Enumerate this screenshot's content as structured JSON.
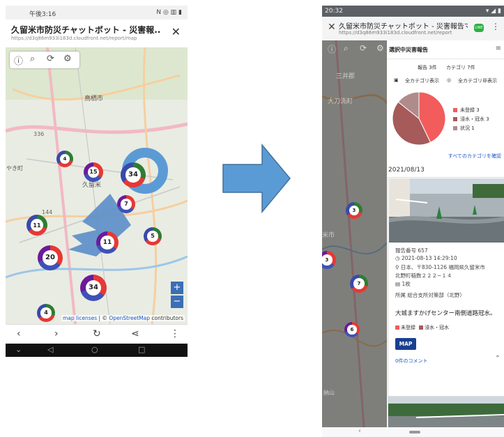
{
  "left_phone": {
    "status_time": "午後3:16",
    "status_right": "N ◎ ▥ ▮",
    "page_title": "久留米市防災チャットボット - 災害報...",
    "url": "https://d3q86m933i183d.cloudfront.net/report/map",
    "map_labels": [
      "鳥栖市",
      "336",
      "やき町",
      "144",
      "久留米"
    ],
    "clusters": [
      "4",
      "15",
      "34",
      "7",
      "11",
      "11",
      "5",
      "20",
      "34",
      "4"
    ],
    "attribution": {
      "link1": "map licenses",
      "sep": " | © ",
      "link2": "OpenStreetMap",
      "suffix": " contributors"
    },
    "zoom_in": "+",
    "zoom_out": "−"
  },
  "right_phone": {
    "status_time": "20:32",
    "status_right": "▾ ◢ ▮",
    "page_title": "久留米市防災チャットボット - 災害報告マ...",
    "url": "https://d3q86m933i183d.cloudfront.net/report",
    "line_badge": "LINE",
    "map_labels": [
      "三井郡",
      "大刀洗町",
      "米市",
      "納山"
    ],
    "map_clusters": [
      "3",
      "3",
      "7",
      "6"
    ],
    "panel": {
      "header": "選択中災害報告",
      "report_count": "報告 3件",
      "category_count": "カテゴリ 7件",
      "show_all": "全カテゴリ表示",
      "hide_all": "全カテゴリ非表示",
      "confirm_all_categories": "すべてのカテゴリを確認"
    },
    "chart_data": {
      "type": "pie",
      "categories": [
        "未登録",
        "浸水・冠水",
        "状況"
      ],
      "values": [
        3,
        3,
        1
      ],
      "colors": [
        "#f25c5c",
        "#a65a5a",
        "#b08b8b"
      ],
      "legend": [
        "未登録 3",
        "浸水・冠水 3",
        "状況 1"
      ]
    },
    "report": {
      "date": "2021/08/13",
      "number": "報告番号 657",
      "datetime": "2021-08-13 14:29:10",
      "address_line1": "日本、〒830-1126 福岡県久留米市",
      "address_line2": "北野町稲数２２２−１４",
      "photo_count": "1枚",
      "department": "所属 総合支所対策部（北野）",
      "description": "大城ますかげセンター南側道路冠水。",
      "tags": [
        "未登録",
        "浸水・冠水"
      ],
      "map_button": "MAP",
      "comments": "0件のコメント"
    }
  }
}
